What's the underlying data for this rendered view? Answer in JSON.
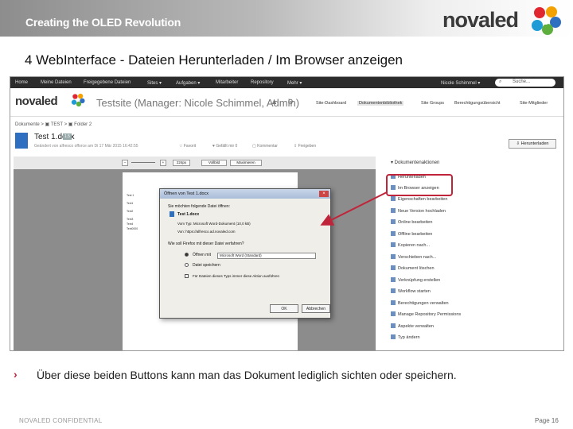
{
  "banner": {
    "title": "Creating the OLED Revolution"
  },
  "logo": {
    "word": "novaled"
  },
  "slide": {
    "title": "4 WebInterface - Dateien Herunterladen / Im Browser anzeigen"
  },
  "navbar": {
    "items": [
      "Home",
      "Meine Dateien",
      "Freigegebene Dateien",
      "Sites ▾",
      "Aufgaben ▾",
      "Mitarbeiter",
      "Repository",
      "Mehr ▾"
    ],
    "user": "Nicole Schimmel ▾",
    "search_placeholder": "Suche..."
  },
  "site": {
    "logo": "novaled",
    "title": "Testsite (Manager: Nicole Schimmel, Admin)",
    "nav": [
      "Site-Dashboard",
      "Dokumentenbibliothek",
      "Site Groups",
      "Berechtigungsübersicht",
      "Site-Mitglieder"
    ]
  },
  "breadcrumb": "Dokumente  >  ▣ TEST  >  ▣ Folder 2",
  "document": {
    "title": "Test 1.docx",
    "version": "1.5",
    "meta": "Geändert von alfresco offorce am Di 17 Mär 2015 16:42:55",
    "actions": [
      "☆ Favorit",
      "♥ Gefällt mir  0",
      "▢ Kommentar",
      "⇪ Freigeben"
    ],
    "download_button": "⇩ Herunterladen"
  },
  "viewer": {
    "zoom": "224px",
    "btn_full": "Vollbild",
    "btn_max": "Maximieren",
    "page_lines": [
      "Test 1",
      "Text1",
      "Text2",
      "Text3",
      "Text4",
      "Text0000"
    ]
  },
  "dialog": {
    "title": "Öffnen von Test 1.docx",
    "intro": "Sie möchten folgende Datei öffnen:",
    "filename": "Test 1.docx",
    "type": "Vom Typ:  Microsoft Word-Dokument (10,0 kB)",
    "source": "Von:  https://alfresco.ad.novaled.com",
    "question": "Wie soll Firefox mit dieser Datei verfahren?",
    "open_with_label": "Öffnen mit",
    "open_with_value": "Microsoft Word (Standard)",
    "save_label": "Datei speichern",
    "remember_label": "Für Dateien dieses Typs immer diese Aktion ausführen",
    "ok": "OK",
    "cancel": "Abbrechen"
  },
  "panel": {
    "heading": "▾ Dokumentenaktionen",
    "items": [
      "Herunterladen",
      "Im Browser anzeigen",
      "Eigenschaften bearbeiten",
      "Neue Version hochladen",
      "Online bearbeiten",
      "Offline bearbeiten",
      "Kopieren nach...",
      "Verschieben nach...",
      "Dokument löschen",
      "Verknüpfung erstellen",
      "Workflow starten",
      "Berechtigungen verwalten",
      "Manage Repository Permissions",
      "Aspekte verwalten",
      "Typ ändern"
    ]
  },
  "bullet": {
    "mark": "›",
    "text": "Über diese beiden Buttons kann man das Dokument lediglich sichten oder speichern."
  },
  "footer": {
    "left": "NOVALED CONFIDENTIAL",
    "right": "Page 16"
  },
  "colors": {
    "accent": "#c0243a",
    "navbar": "#2c2c2c",
    "brand_blue": "#2f6fc2"
  }
}
